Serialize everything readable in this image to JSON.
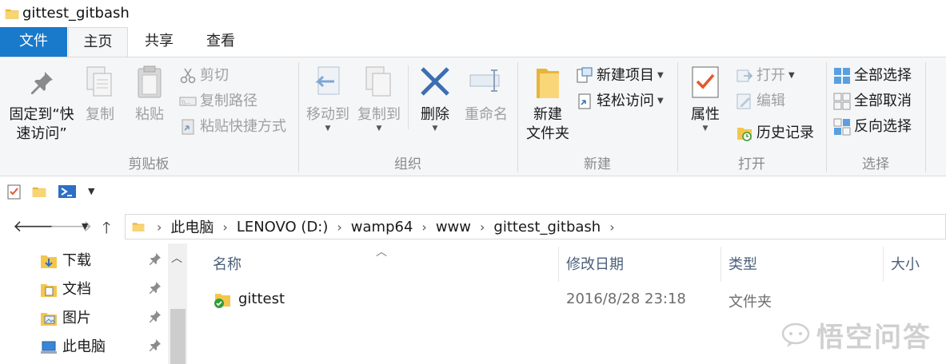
{
  "window": {
    "title": "gittest_gitbash"
  },
  "tabs": [
    {
      "label": "文件"
    },
    {
      "label": "主页"
    },
    {
      "label": "共享"
    },
    {
      "label": "查看"
    }
  ],
  "ribbon": {
    "clipboard": {
      "label": "剪贴板",
      "pin_line1": "固定到“快",
      "pin_line2": "速访问”",
      "copy": "复制",
      "paste": "粘贴",
      "cut": "剪切",
      "copy_path": "复制路径",
      "paste_shortcut": "粘贴快捷方式"
    },
    "organize": {
      "label": "组织",
      "move_to": "移动到",
      "copy_to": "复制到",
      "delete": "删除",
      "rename": "重命名"
    },
    "new": {
      "label": "新建",
      "new_folder_line1": "新建",
      "new_folder_line2": "文件夹",
      "new_item": "新建项目",
      "easy_access": "轻松访问"
    },
    "open": {
      "label": "打开",
      "properties": "属性",
      "open": "打开",
      "edit": "编辑",
      "history": "历史记录"
    },
    "select": {
      "label": "选择",
      "select_all": "全部选择",
      "select_none": "全部取消",
      "invert": "反向选择"
    }
  },
  "address": {
    "crumbs": [
      "此电脑",
      "LENOVO (D:)",
      "wamp64",
      "www",
      "gittest_gitbash"
    ]
  },
  "navpane": {
    "items": [
      {
        "label": "下载"
      },
      {
        "label": "文档"
      },
      {
        "label": "图片"
      },
      {
        "label": "此电脑"
      }
    ]
  },
  "filelist": {
    "columns": {
      "name": "名称",
      "modified": "修改日期",
      "type": "类型",
      "size": "大小"
    },
    "rows": [
      {
        "name": "gittest",
        "modified": "2016/8/28 23:18",
        "type": "文件夹"
      }
    ]
  },
  "watermark": {
    "text": "悟空问答"
  },
  "colors": {
    "accent": "#1979ca",
    "folder": "#f4c64c",
    "ribbon_bg": "#f5f6f7"
  }
}
